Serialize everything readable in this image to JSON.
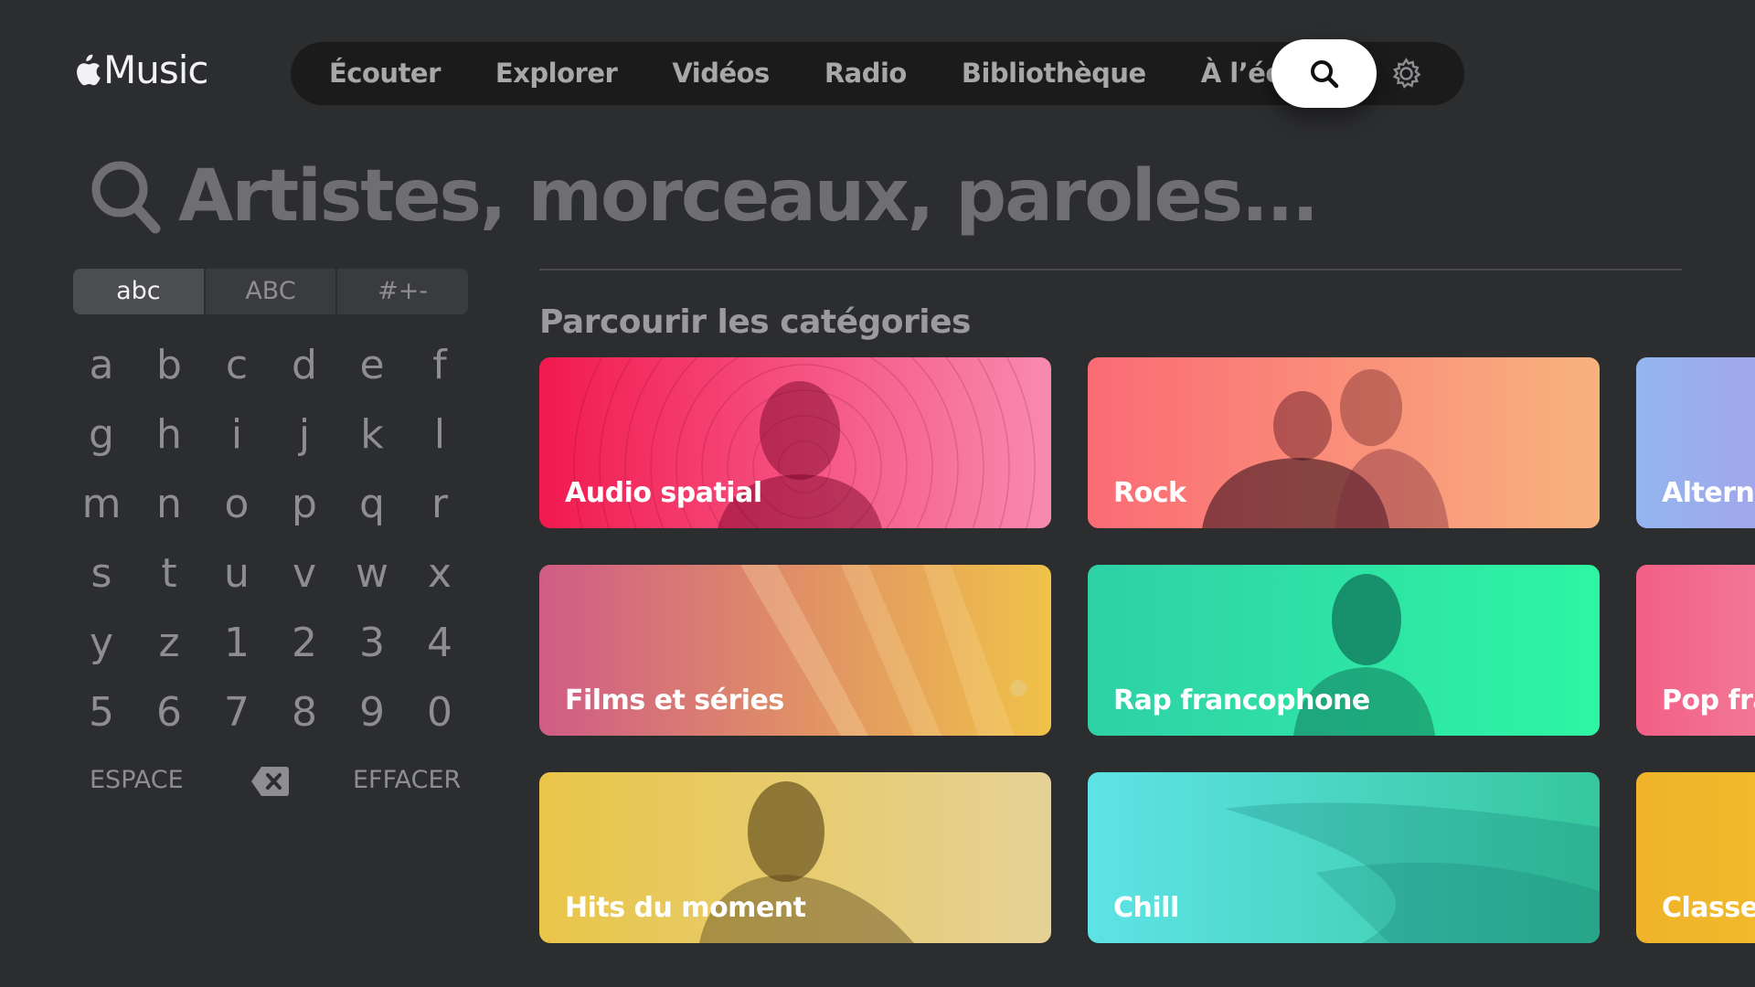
{
  "app": {
    "logo_text": "Music",
    "logo_icon": "apple-icon"
  },
  "nav": {
    "items": [
      {
        "label": "Écouter"
      },
      {
        "label": "Explorer"
      },
      {
        "label": "Vidéos"
      },
      {
        "label": "Radio"
      },
      {
        "label": "Bibliothèque"
      },
      {
        "label": "À l’écoute"
      }
    ],
    "search_icon": "search-icon",
    "settings_icon": "gear-icon",
    "selected": "search"
  },
  "search": {
    "placeholder": "Artistes, morceaux, paroles..."
  },
  "keyboard": {
    "modes": [
      {
        "label": "abc",
        "active": true
      },
      {
        "label": "ABC",
        "active": false
      },
      {
        "label": "#+-",
        "active": false
      }
    ],
    "keys": [
      "a",
      "b",
      "c",
      "d",
      "e",
      "f",
      "g",
      "h",
      "i",
      "j",
      "k",
      "l",
      "m",
      "n",
      "o",
      "p",
      "q",
      "r",
      "s",
      "t",
      "u",
      "v",
      "w",
      "x",
      "y",
      "z",
      "1",
      "2",
      "3",
      "4",
      "5",
      "6",
      "7",
      "8",
      "9",
      "0"
    ],
    "space_label": "ESPACE",
    "backspace_icon": "backspace-icon",
    "clear_label": "EFFACER"
  },
  "categories": {
    "title": "Parcourir les catégories",
    "tiles": [
      {
        "label": "Audio spatial",
        "colors": [
          "#f2194f",
          "#f88ab0"
        ]
      },
      {
        "label": "Rock",
        "colors": [
          "#fb6b75",
          "#f8b27e"
        ]
      },
      {
        "label": "Alterna",
        "colors": [
          "#93b6ef",
          "#a3a4ea"
        ]
      },
      {
        "label": "Films et séries",
        "colors": [
          "#cf5c86",
          "#f0c248"
        ]
      },
      {
        "label": "Rap francophone",
        "colors": [
          "#2fd0a6",
          "#2ef5a3"
        ]
      },
      {
        "label": "Pop fra",
        "colors": [
          "#f25f86",
          "#f27a97"
        ]
      },
      {
        "label": "Hits du moment",
        "colors": [
          "#e9c648",
          "#e5d196"
        ]
      },
      {
        "label": "Chill",
        "colors": [
          "#5ee3e6",
          "#35c79d"
        ]
      },
      {
        "label": "Classe",
        "colors": [
          "#f0b32a",
          "#f2ba2c"
        ]
      }
    ]
  }
}
